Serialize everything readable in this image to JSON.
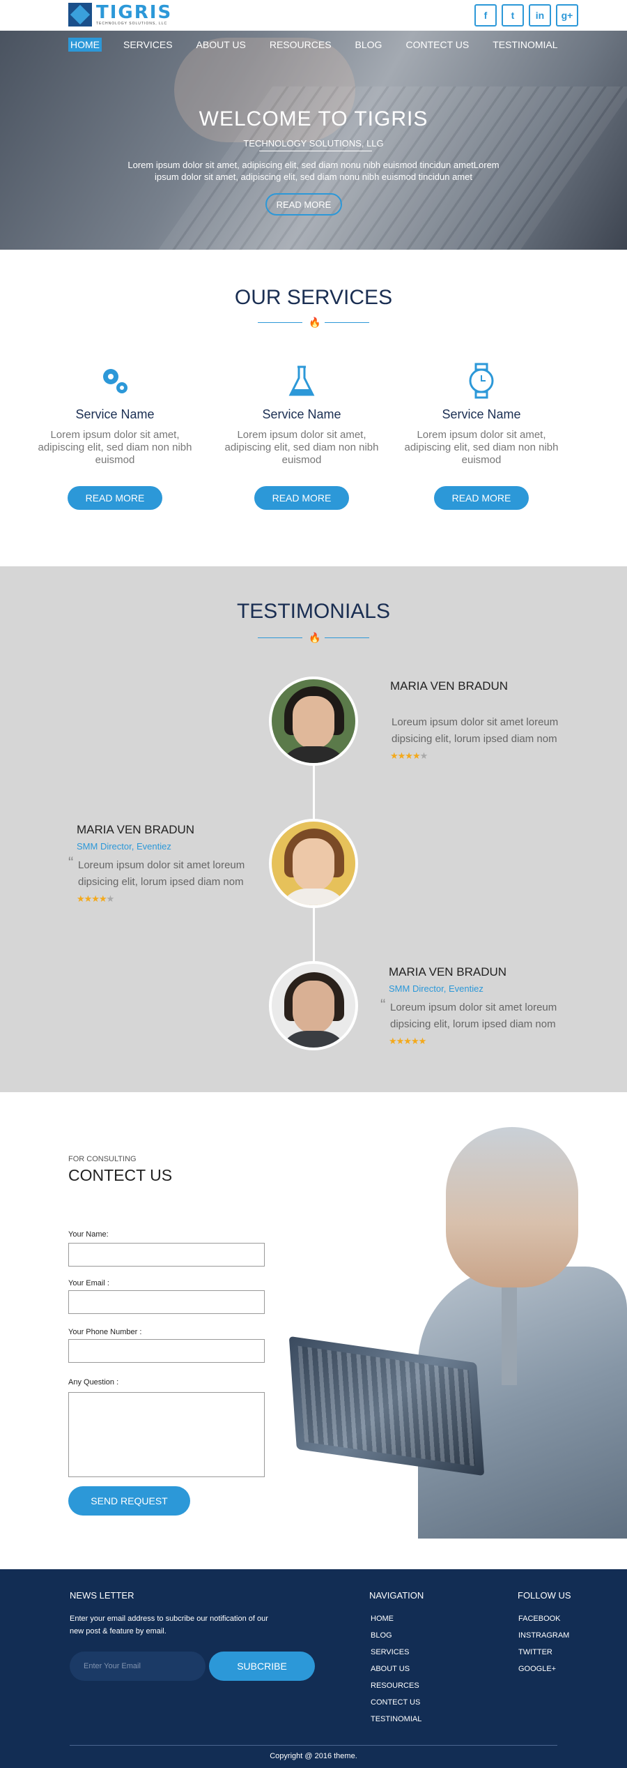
{
  "header": {
    "logo_name": "TIGRIS",
    "logo_sub": "TECHNOLOGY SOLUTIONS, LLC",
    "social": [
      "f",
      "t",
      "in",
      "g+"
    ]
  },
  "nav": [
    "HOME",
    "SERVICES",
    "ABOUT US",
    "RESOURCES",
    "BLOG",
    "CONTECT US",
    "TESTINOMIAL"
  ],
  "hero": {
    "title": "WELCOME TO TIGRIS",
    "tagline": "TECHNOLOGY SOLUTIONS, LLG",
    "intro": "Lorem ipsum dolor sit amet, adipiscing elit, sed diam nonu nibh euismod tincidun ametLorem ipsum dolor sit amet, adipiscing elit, sed diam nonu nibh euismod tincidun amet",
    "button": "READ MORE"
  },
  "services": {
    "title": "OUR SERVICES",
    "items": [
      {
        "icon": "gears-icon",
        "name": "Service Name",
        "text": "Lorem ipsum dolor sit amet, adipiscing elit, sed diam non nibh euismod",
        "button": "READ MORE"
      },
      {
        "icon": "flask-icon",
        "name": "Service Name",
        "text": "Lorem ipsum dolor sit amet, adipiscing elit, sed diam non nibh euismod",
        "button": "READ MORE"
      },
      {
        "icon": "watch-icon",
        "name": "Service Name",
        "text": "Lorem ipsum dolor sit amet, adipiscing elit, sed diam non nibh euismod",
        "button": "READ MORE"
      }
    ]
  },
  "testimonials": {
    "title": "TESTIMONIALS",
    "items": [
      {
        "name": "MARIA VEN BRADUN",
        "role": "",
        "quote": "Loreum ipsum dolor sit amet loreum dipsicing elit,  lorum ipsed diam nom",
        "rating": 4
      },
      {
        "name": "MARIA VEN BRADUN",
        "role": "SMM Director, Eventiez",
        "quote": "Loreum ipsum dolor sit amet loreum dipsicing elit,  lorum ipsed diam nom",
        "rating": 4
      },
      {
        "name": "MARIA VEN BRADUN",
        "role": "SMM Director, Eventiez",
        "quote": "Loreum ipsum dolor sit amet loreum dipsicing elit,  lorum ipsed diam nom",
        "rating": 5
      }
    ]
  },
  "contact": {
    "kicker": "FOR CONSULTING",
    "title": "CONTECT US",
    "labels": {
      "name": "Your Name:",
      "email": "Your Email :",
      "phone": "Your Phone Number :",
      "question": "Any Question :"
    },
    "button": "SEND REQUEST"
  },
  "footer": {
    "newsletter_title": "NEWS LETTER",
    "newsletter_text": "Enter your email address to subcribe our notification of our new post & feature by email.",
    "email_placeholder": "Enter Your Email",
    "subscribe": "SUBCRIBE",
    "nav_title": "NAVIGATION",
    "nav_items": [
      "HOME",
      "BLOG",
      "SERVICES",
      "ABOUT US",
      "RESOURCES",
      "CONTECT US",
      "TESTINOMIAL"
    ],
    "follow_title": "FOLLOW US",
    "follow_items": [
      "FACEBOOK",
      "INSTRAGRAM",
      "TWITTER",
      "GOOGLE+"
    ],
    "copyright": "Copyright @ 2016 theme."
  },
  "colors": {
    "accent": "#2c98d8",
    "navy": "#122d54",
    "testimonial_bg": "#d6d6d6"
  }
}
